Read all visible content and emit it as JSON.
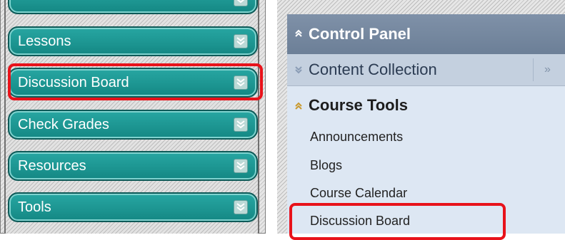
{
  "left_nav": {
    "items": [
      {
        "label": ""
      },
      {
        "label": "Lessons"
      },
      {
        "label": "Discussion Board"
      },
      {
        "label": "Check Grades"
      },
      {
        "label": "Resources"
      },
      {
        "label": "Tools"
      }
    ],
    "highlighted_item": "Discussion Board"
  },
  "control_panel": {
    "title": "Control Panel",
    "content_collection": {
      "label": "Content Collection",
      "more_glyph": "»"
    },
    "course_tools": {
      "title": "Course Tools",
      "links": [
        "Announcements",
        "Blogs",
        "Course Calendar",
        "Discussion Board"
      ]
    },
    "highlighted_link": "Discussion Board"
  },
  "colors": {
    "nav_button": "#1d9692",
    "highlight": "#e8121a",
    "panel_header": "#7385a0",
    "tools_background": "#dde7f3"
  },
  "icons": {
    "nav_expand": "double-chevron-down-icon",
    "header_collapse": "double-chevron-up-icon",
    "collection_expand": "double-chevron-down-icon",
    "collection_more": "double-chevron-right-icon"
  }
}
